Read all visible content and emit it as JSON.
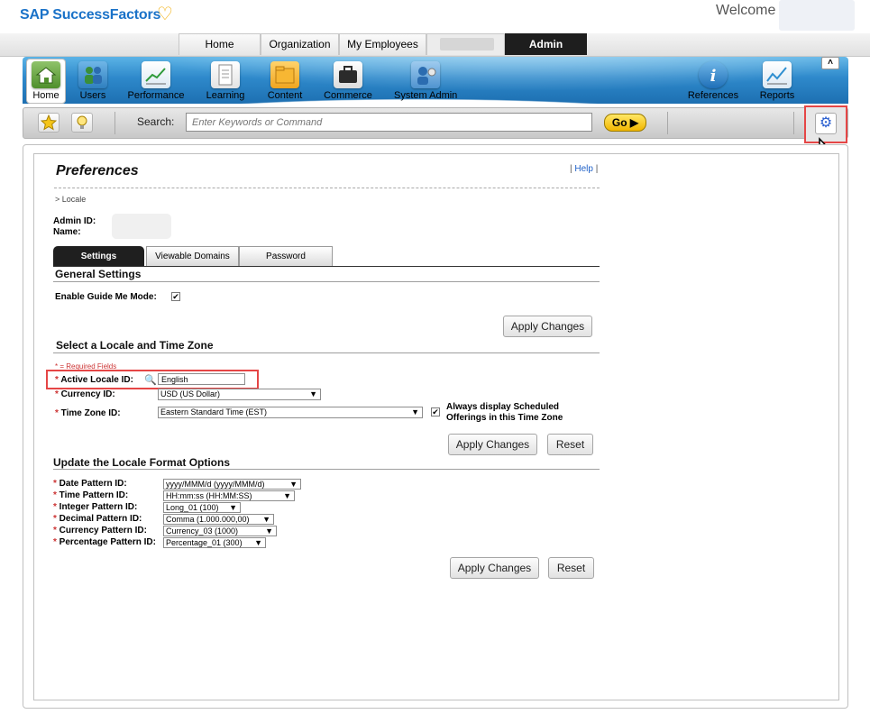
{
  "header": {
    "brand": "SAP SuccessFactors",
    "welcome": "Welcome"
  },
  "top_tabs": [
    "Home",
    "Organization",
    "My Employees",
    "Admin"
  ],
  "nav": {
    "items": [
      {
        "label": "Home",
        "icon": "home-icon"
      },
      {
        "label": "Users",
        "icon": "users-icon"
      },
      {
        "label": "Performance",
        "icon": "performance-chart-icon"
      },
      {
        "label": "Learning",
        "icon": "document-icon"
      },
      {
        "label": "Content",
        "icon": "folder-icon"
      },
      {
        "label": "Commerce",
        "icon": "briefcase-icon"
      },
      {
        "label": "System Admin",
        "icon": "system-admin-icon"
      },
      {
        "label": "References",
        "icon": "info-icon"
      },
      {
        "label": "Reports",
        "icon": "reports-chart-icon"
      }
    ],
    "collapse": "˄"
  },
  "toolbar": {
    "search_label": "Search:",
    "search_placeholder": "Enter Keywords or Command",
    "go_label": "Go ▶"
  },
  "prefs": {
    "title": "Preferences",
    "help": "Help",
    "breadcrumb": "> Locale",
    "admin_id_label": "Admin ID:",
    "name_label": "Name:",
    "tabs": [
      "Settings",
      "Viewable Domains",
      "Password"
    ],
    "general": {
      "heading": "General Settings",
      "guide_label": "Enable Guide Me Mode:",
      "guide_checked": "✔",
      "apply": "Apply Changes"
    },
    "locale": {
      "heading": "Select a Locale and Time Zone",
      "required_note": "* = Required Fields",
      "active_locale_label": "Active Locale ID:",
      "active_locale_value": "English",
      "currency_label": "Currency ID:",
      "currency_value": "USD (US Dollar)",
      "tz_label": "Time Zone ID:",
      "tz_value": "Eastern Standard Time (EST)",
      "tz_checkbox": "✔",
      "tz_always": "Always display Scheduled Offerings in this Time Zone",
      "apply": "Apply Changes",
      "reset": "Reset"
    },
    "format": {
      "heading": "Update the Locale Format Options",
      "rows": [
        {
          "label": "Date Pattern ID:",
          "value": "yyyy/MMM/d (yyyy/MMM/d)"
        },
        {
          "label": "Time Pattern ID:",
          "value": "HH:mm:ss (HH:MM:SS)"
        },
        {
          "label": "Integer Pattern ID:",
          "value": "Long_01 (100)"
        },
        {
          "label": "Decimal Pattern ID:",
          "value": "Comma (1.000.000,00)"
        },
        {
          "label": "Currency Pattern ID:",
          "value": "Currency_03 (1000)"
        },
        {
          "label": "Percentage Pattern ID:",
          "value": "Percentage_01 (300)"
        }
      ],
      "apply": "Apply Changes",
      "reset": "Reset"
    }
  },
  "colors": {
    "brand": "#1a72c8",
    "nav_blue": "#2e89cb",
    "highlight": "#e54646",
    "go_button": "#f2b600"
  }
}
